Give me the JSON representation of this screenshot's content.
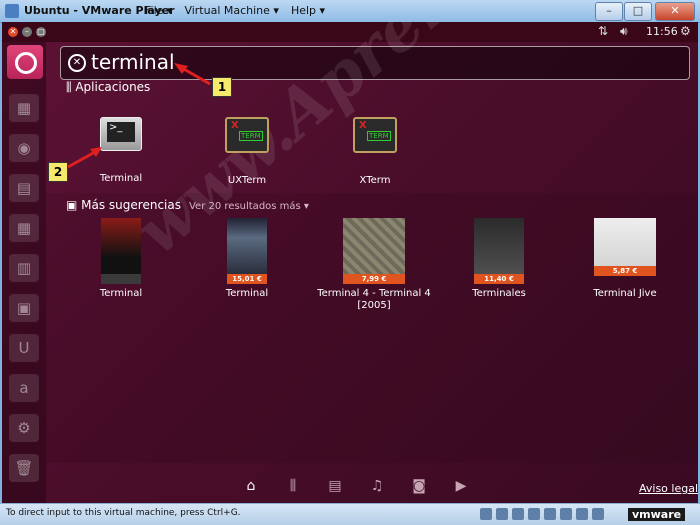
{
  "window": {
    "title": "Ubuntu - VMware Player",
    "menus": [
      "File ▾",
      "Virtual Machine ▾",
      "Help ▾"
    ]
  },
  "panel": {
    "clock": "11:56"
  },
  "search": {
    "query": "terminal"
  },
  "applications": {
    "header": "Aplicaciones",
    "items": [
      {
        "label": "Terminal"
      },
      {
        "label": "UXTerm"
      },
      {
        "label": "XTerm"
      }
    ]
  },
  "suggestions": {
    "header": "Más sugerencias",
    "more": "Ver 20 resultados más ▾",
    "items": [
      {
        "label": "Terminal",
        "price": ""
      },
      {
        "label": "Terminal",
        "price": "15,01 €"
      },
      {
        "label": "Terminal 4 - Terminal 4 [2005]",
        "price": "7,99 €"
      },
      {
        "label": "Terminales",
        "price": "11,40 €"
      },
      {
        "label": "Terminal Jive",
        "price": "5,87 €"
      }
    ]
  },
  "watermark": "www.AprendeAndroid.com",
  "lens_bar": {
    "icons": [
      "home-icon",
      "applications-icon",
      "files-icon",
      "music-icon",
      "photos-icon",
      "video-icon"
    ]
  },
  "footer": {
    "legal": "Aviso legal"
  },
  "callouts": [
    "1",
    "2"
  ],
  "statusbar": {
    "message": "To direct input to this virtual machine, press Ctrl+G.",
    "brand": "vmware"
  },
  "colors": {
    "dash_bg": "#4a0d2a",
    "launcher_home": "#d23b6e",
    "price_tag": "#e0551f",
    "callout": "#f6e96b"
  }
}
